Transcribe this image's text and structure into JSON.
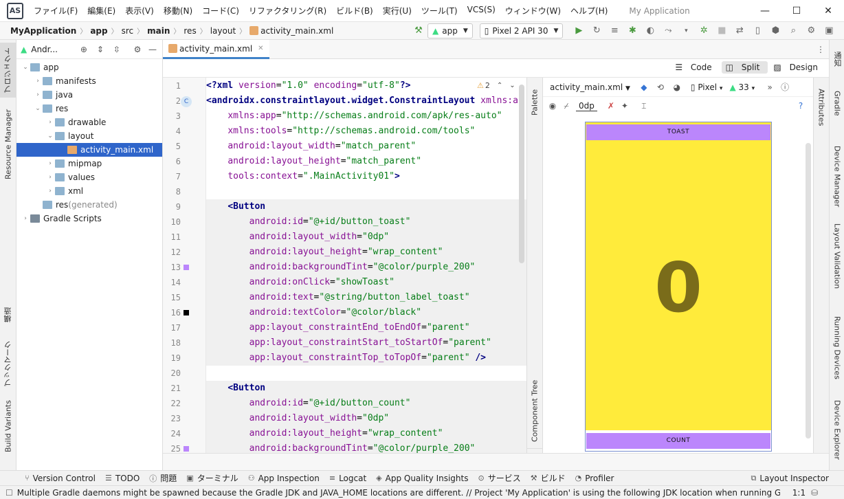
{
  "window": {
    "menu": [
      "ファイル(F)",
      "編集(E)",
      "表示(V)",
      "移動(N)",
      "コード(C)",
      "リファクタリング(R)",
      "ビルド(B)",
      "実行(U)",
      "ツール(T)",
      "VCS(S)",
      "ウィンドウ(W)",
      "ヘルプ(H)"
    ],
    "title": "My Application"
  },
  "breadcrumb": [
    "MyApplication",
    "app",
    "src",
    "main",
    "res",
    "layout",
    "activity_main.xml"
  ],
  "run": {
    "config": "app",
    "device": "Pixel 2 API 30"
  },
  "left_tabs": {
    "project": "プロジェクト",
    "resource_manager": "Resource Manager",
    "structure": "構造",
    "bookmarks": "ブックマーク",
    "build_variants": "Build Variants"
  },
  "project": {
    "view": "Andr...",
    "tree": [
      {
        "label": "app",
        "level": 0,
        "exp": "open"
      },
      {
        "label": "manifests",
        "level": 1,
        "exp": "closed"
      },
      {
        "label": "java",
        "level": 1,
        "exp": "closed"
      },
      {
        "label": "res",
        "level": 1,
        "exp": "open"
      },
      {
        "label": "drawable",
        "level": 2,
        "exp": "closed"
      },
      {
        "label": "layout",
        "level": 2,
        "exp": "open"
      },
      {
        "label": "activity_main.xml",
        "level": 3,
        "exp": "none",
        "selected": true
      },
      {
        "label": "mipmap",
        "level": 2,
        "exp": "closed"
      },
      {
        "label": "values",
        "level": 2,
        "exp": "closed"
      },
      {
        "label": "xml",
        "level": 2,
        "exp": "closed"
      },
      {
        "label": "res",
        "suffix": " (generated)",
        "level": 1,
        "exp": "none"
      },
      {
        "label": "Gradle Scripts",
        "level": 0,
        "exp": "closed"
      }
    ]
  },
  "editor": {
    "tab": "activity_main.xml",
    "modes": {
      "code": "Code",
      "split": "Split",
      "design": "Design"
    },
    "warnings": "2",
    "lines": [
      {
        "n": "1",
        "parts": [
          [
            "t",
            "<?xml "
          ],
          [
            "a",
            "version"
          ],
          [
            "p",
            "="
          ],
          [
            "v",
            "\"1.0\""
          ],
          [
            "p",
            " "
          ],
          [
            "a",
            "encoding"
          ],
          [
            "p",
            "="
          ],
          [
            "v",
            "\"utf-8\""
          ],
          [
            "t",
            "?>"
          ]
        ]
      },
      {
        "n": "2",
        "parts": [
          [
            "t",
            "<androidx.constraintlayout.widget.ConstraintLayout "
          ],
          [
            "a",
            "xmlns:a"
          ]
        ]
      },
      {
        "n": "3",
        "parts": [
          [
            "p",
            "    "
          ],
          [
            "a",
            "xmlns:app"
          ],
          [
            "p",
            "="
          ],
          [
            "v",
            "\"http://schemas.android.com/apk/res-auto\""
          ]
        ]
      },
      {
        "n": "4",
        "parts": [
          [
            "p",
            "    "
          ],
          [
            "a",
            "xmlns:tools"
          ],
          [
            "p",
            "="
          ],
          [
            "v",
            "\"http://schemas.android.com/tools\""
          ]
        ]
      },
      {
        "n": "5",
        "parts": [
          [
            "p",
            "    "
          ],
          [
            "a",
            "android:layout_width"
          ],
          [
            "p",
            "="
          ],
          [
            "v",
            "\"match_parent\""
          ]
        ]
      },
      {
        "n": "6",
        "parts": [
          [
            "p",
            "    "
          ],
          [
            "a",
            "android:layout_height"
          ],
          [
            "p",
            "="
          ],
          [
            "v",
            "\"match_parent\""
          ]
        ]
      },
      {
        "n": "7",
        "parts": [
          [
            "p",
            "    "
          ],
          [
            "a",
            "tools:context"
          ],
          [
            "p",
            "="
          ],
          [
            "v",
            "\".MainActivity01\""
          ],
          [
            "t",
            ">"
          ]
        ]
      },
      {
        "n": "8",
        "parts": []
      },
      {
        "n": "9",
        "parts": [
          [
            "p",
            "    "
          ],
          [
            "t",
            "<Button"
          ]
        ]
      },
      {
        "n": "10",
        "parts": [
          [
            "p",
            "        "
          ],
          [
            "a",
            "android:id"
          ],
          [
            "p",
            "="
          ],
          [
            "v",
            "\"@+id/button_toast\""
          ]
        ]
      },
      {
        "n": "11",
        "parts": [
          [
            "p",
            "        "
          ],
          [
            "a",
            "android:layout_width"
          ],
          [
            "p",
            "="
          ],
          [
            "v",
            "\"0dp\""
          ]
        ]
      },
      {
        "n": "12",
        "parts": [
          [
            "p",
            "        "
          ],
          [
            "a",
            "android:layout_height"
          ],
          [
            "p",
            "="
          ],
          [
            "v",
            "\"wrap_content\""
          ]
        ]
      },
      {
        "n": "13",
        "parts": [
          [
            "p",
            "        "
          ],
          [
            "a",
            "android:backgroundTint"
          ],
          [
            "p",
            "="
          ],
          [
            "v",
            "\"@color/purple_200\""
          ]
        ]
      },
      {
        "n": "14",
        "parts": [
          [
            "p",
            "        "
          ],
          [
            "a",
            "android:onClick"
          ],
          [
            "p",
            "="
          ],
          [
            "v",
            "\"showToast\""
          ]
        ]
      },
      {
        "n": "15",
        "parts": [
          [
            "p",
            "        "
          ],
          [
            "a",
            "android:text"
          ],
          [
            "p",
            "="
          ],
          [
            "v",
            "\"@string/button_label_toast\""
          ]
        ]
      },
      {
        "n": "16",
        "parts": [
          [
            "p",
            "        "
          ],
          [
            "a",
            "android:textColor"
          ],
          [
            "p",
            "="
          ],
          [
            "v",
            "\"@color/black\""
          ]
        ]
      },
      {
        "n": "17",
        "parts": [
          [
            "p",
            "        "
          ],
          [
            "a",
            "app:layout_constraintEnd_toEndOf"
          ],
          [
            "p",
            "="
          ],
          [
            "v",
            "\"parent\""
          ]
        ]
      },
      {
        "n": "18",
        "parts": [
          [
            "p",
            "        "
          ],
          [
            "a",
            "app:layout_constraintStart_toStartOf"
          ],
          [
            "p",
            "="
          ],
          [
            "v",
            "\"parent\""
          ]
        ]
      },
      {
        "n": "19",
        "parts": [
          [
            "p",
            "        "
          ],
          [
            "a",
            "app:layout_constraintTop_toTopOf"
          ],
          [
            "p",
            "="
          ],
          [
            "v",
            "\"parent\""
          ],
          [
            "p",
            " "
          ],
          [
            "t",
            "/>"
          ]
        ]
      },
      {
        "n": "20",
        "parts": []
      },
      {
        "n": "21",
        "parts": [
          [
            "p",
            "    "
          ],
          [
            "t",
            "<Button"
          ]
        ]
      },
      {
        "n": "22",
        "parts": [
          [
            "p",
            "        "
          ],
          [
            "a",
            "android:id"
          ],
          [
            "p",
            "="
          ],
          [
            "v",
            "\"@+id/button_count\""
          ]
        ]
      },
      {
        "n": "23",
        "parts": [
          [
            "p",
            "        "
          ],
          [
            "a",
            "android:layout_width"
          ],
          [
            "p",
            "="
          ],
          [
            "v",
            "\"0dp\""
          ]
        ]
      },
      {
        "n": "24",
        "parts": [
          [
            "p",
            "        "
          ],
          [
            "a",
            "android:layout_height"
          ],
          [
            "p",
            "="
          ],
          [
            "v",
            "\"wrap_content\""
          ]
        ]
      },
      {
        "n": "25",
        "parts": [
          [
            "p",
            "        "
          ],
          [
            "a",
            "android:backgroundTint"
          ],
          [
            "p",
            "="
          ],
          [
            "v",
            "\"@color/purple_200\""
          ]
        ]
      }
    ],
    "swatches": {
      "purple": "#bb86fc",
      "black": "#000000"
    }
  },
  "side_tabs": {
    "palette": "Palette",
    "component_tree": "Component Tree",
    "attributes": "Attributes"
  },
  "design": {
    "file": "activity_main.xml",
    "device": "Pixel",
    "api": "33",
    "margin": "0dp",
    "toast_label": "TOAST",
    "count_label": "COUNT",
    "count_value": "0",
    "background": "#ffeb3b",
    "button_color": "#bb86fc"
  },
  "right_tabs": {
    "notifications": "通知",
    "gradle": "Gradle",
    "device_manager": "Device Manager",
    "layout_validation": "Layout Validation",
    "running_devices": "Running Devices",
    "device_explorer": "Device Explorer"
  },
  "tool_windows": [
    "Version Control",
    "TODO",
    "問題",
    "ターミナル",
    "App Inspection",
    "Logcat",
    "App Quality Insights",
    "サービス",
    "ビルド",
    "Profiler"
  ],
  "layout_inspector": "Layout Inspector",
  "status": {
    "message": "Multiple Gradle daemons might be spawned because the Gradle JDK and JAVA_HOME locations are different. // Project 'My Application' is using the following JDK location when running Gradle: // 'C:/Pr... (今)",
    "position": "1:1"
  }
}
